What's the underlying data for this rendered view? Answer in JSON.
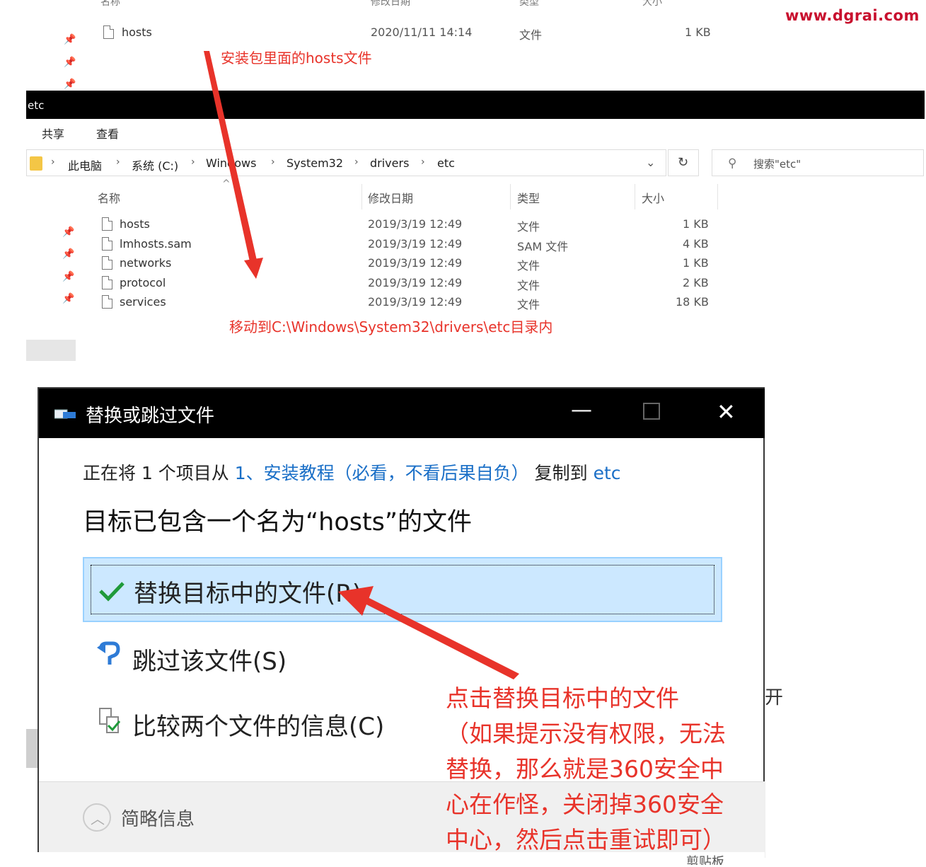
{
  "brand": "www.dgrai.com",
  "top_file": {
    "name": "hosts",
    "date": "2020/11/11 14:14",
    "type": "文件",
    "size": "1 KB"
  },
  "top_headers": [
    "名称",
    "修改日期",
    "类型",
    "大小"
  ],
  "annotation_top": "安装包里面的hosts文件",
  "explorer": {
    "title": "etc",
    "ribbon": [
      "共享",
      "查看"
    ],
    "breadcrumb": [
      "此电脑",
      "系统 (C:)",
      "Windows",
      "System32",
      "drivers",
      "etc"
    ],
    "search_placeholder": "搜索\"etc\"",
    "headers": {
      "name": "名称",
      "date": "修改日期",
      "type": "类型",
      "size": "大小"
    },
    "files": [
      {
        "name": "hosts",
        "date": "2019/3/19 12:49",
        "type": "文件",
        "size": "1 KB"
      },
      {
        "name": "lmhosts.sam",
        "date": "2019/3/19 12:49",
        "type": "SAM 文件",
        "size": "4 KB"
      },
      {
        "name": "networks",
        "date": "2019/3/19 12:49",
        "type": "文件",
        "size": "1 KB"
      },
      {
        "name": "protocol",
        "date": "2019/3/19 12:49",
        "type": "文件",
        "size": "2 KB"
      },
      {
        "name": "services",
        "date": "2019/3/19 12:49",
        "type": "文件",
        "size": "18 KB"
      }
    ]
  },
  "annotation_move": "移动到C:\\Windows\\System32\\drivers\\etc目录内",
  "dialog": {
    "title": "替换或跳过文件",
    "line1_prefix": "正在将 1 个项目从 ",
    "line1_source": "1、安装教程（必看，不看后果自负）",
    "line1_mid": " 复制到 ",
    "line1_dest": "etc",
    "line2": "目标已包含一个名为“hosts”的文件",
    "option_replace": "替换目标中的文件(R)",
    "option_skip": "跳过该文件(S)",
    "option_compare": "比较两个文件的信息(C)",
    "footer": "简略信息"
  },
  "annotation_click": [
    "点击替换目标中的文件",
    "（如果提示没有权限，无法",
    "替换，那么就是360安全中",
    "心在作怪，关闭掉360安全",
    "中心，然后点击重试即可）"
  ],
  "colors": {
    "annotation": "#e8332a",
    "brand": "#c8102e",
    "selection": "#cce8ff",
    "link": "#1a6fc7"
  }
}
